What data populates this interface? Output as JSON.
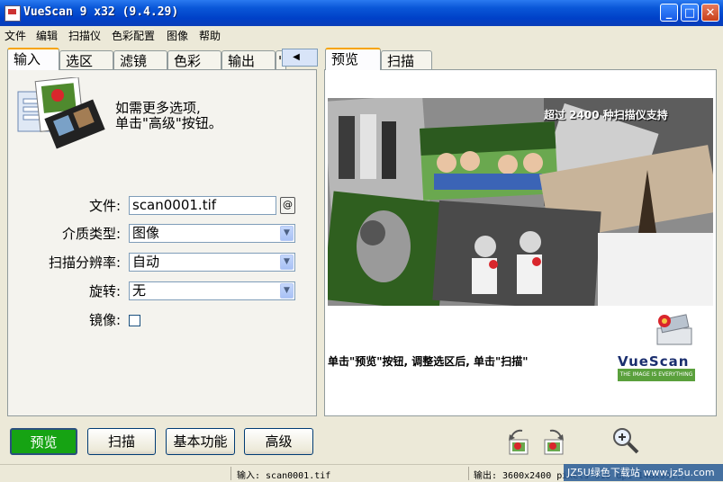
{
  "window": {
    "title": "VueScan 9 x32 (9.4.29)",
    "minimize": "_",
    "maximize": "□",
    "close": "✕"
  },
  "menu": [
    "文件",
    "编辑",
    "扫描仪",
    "色彩配置",
    "图像",
    "帮助"
  ],
  "left_tabs": [
    "输入",
    "选区",
    "滤镜",
    "色彩",
    "输出",
    "'"
  ],
  "tab_scroll": "◀ ▶",
  "right_tabs": [
    "预览",
    "扫描"
  ],
  "hint": {
    "line1": "如需更多选项,",
    "line2": "单击\"高级\"按钮。"
  },
  "form": {
    "file_label": "文件:",
    "file_value": "scan0001.tif",
    "file_btn": "@",
    "media_label": "介质类型:",
    "media_value": "图像",
    "resolution_label": "扫描分辨率:",
    "resolution_value": "自动",
    "rotate_label": "旋转:",
    "rotate_value": "无",
    "mirror_label": "镜像:"
  },
  "promo": {
    "banner": "超过 2400 种扫描仪支持",
    "caption": "单击\"预览\"按钮, 调整选区后, 单击\"扫描\"",
    "logo": "VueScan",
    "logo_tag": "THE IMAGE IS EVERYTHING"
  },
  "buttons": {
    "preview": "预览",
    "scan": "扫描",
    "basic": "基本功能",
    "advanced": "高级"
  },
  "status": {
    "input": "输入: scan0001.tif",
    "output": "输出: 3600x2400 pixels 610 dpi 148x99..."
  },
  "watermark": "JZ5U绿色下载站 www.jz5u.com",
  "colors": {
    "titlebar": "#0a57d8",
    "preview_button": "#16a313",
    "tab_highlight": "#f7a400"
  }
}
